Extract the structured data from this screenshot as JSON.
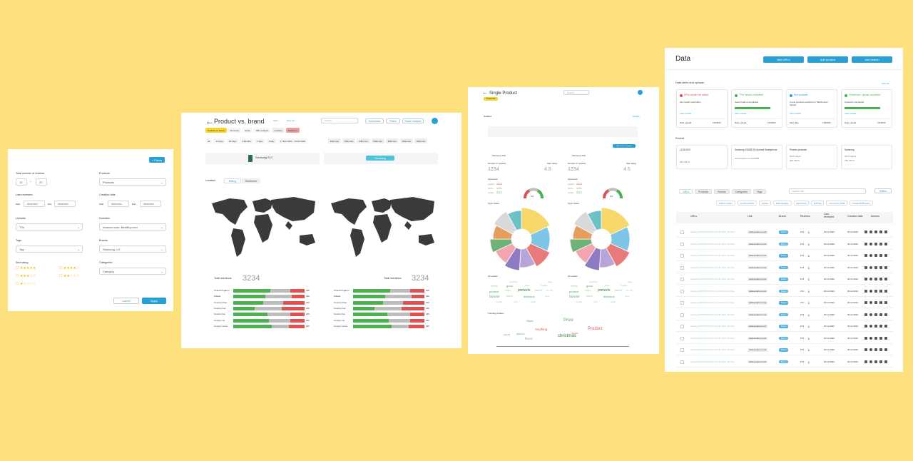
{
  "colors": {
    "bg": "#fde17e",
    "accent": "#2a9fd6",
    "green": "#4caf50",
    "red": "#e05252",
    "grey": "#bdbdbd",
    "yellow": "#f2d331"
  },
  "filters": {
    "edit_btn": "+ Filters",
    "total_reviews_label": "Total number of reviews",
    "reviews_from": "10",
    "reviews_dash": "–",
    "reviews_to": "20",
    "products_label": "Products",
    "products_value": "Products",
    "last_reviewed_label": "Last reviewed",
    "start_label": "Start",
    "start_value": "09/01/2021",
    "end_label": "End",
    "end_value": "09/01/2021",
    "creation_label": "Creation date",
    "creation_start_label": "Start",
    "creation_start_value": "09/01/2021",
    "creation_end_label": "End",
    "creation_end_value": "09/01/2021",
    "uploads_label": "Uploads",
    "uploads_value": "TVs",
    "domains_label": "Domains",
    "domains_value": "Amazon.com, BestBuy.com",
    "tags_label": "Tags",
    "tags_value": "Tag",
    "brands_label": "Brands",
    "brands_value": "Samsung, LG",
    "star_label": "Star rating",
    "categories_label": "Categories",
    "categories_value": "Category",
    "cancel": "Cancel",
    "apply": "Apply"
  },
  "pvb": {
    "title": "Product vs. brand",
    "save": "Save",
    "save_as": "Save As",
    "search_placeholder": "Search",
    "download": "Download",
    "filters": "Filters",
    "share": "Share analysis",
    "tabs": [
      "Product vs. brand",
      "Summary",
      "Entity",
      "HRL analysis",
      "Location",
      "Product 2"
    ],
    "ranges": [
      "All",
      "14 days",
      "30 days",
      "3 Months",
      "7 days",
      "Today",
      "17 Dec 2021 – 3 Feb 2022"
    ],
    "filter_chips": [
      "Filter two",
      "Filter two",
      "Filter two",
      "Filter two",
      "Filter two",
      "Filter two",
      "Filter two"
    ],
    "product_name": "Samsung S10",
    "brand_name": "Samsung",
    "location_label": "Location",
    "rating_tab": "Rating",
    "sentiment_tab": "Sentiment",
    "total_label": "Total mentions",
    "total_value": "3234",
    "countries": [
      "United Kingdom",
      "Poland",
      "Country three",
      "Country four",
      "Country five",
      "Country six",
      "Country seven"
    ],
    "country_values": [
      "400",
      "320",
      "230",
      "230",
      "230",
      "230",
      "230"
    ]
  },
  "single": {
    "title": "Single Product",
    "search_placeholder": "Search",
    "highlight_chip": "Product title",
    "section_label": "Detailed",
    "update_label": "Update",
    "chip_note": "Add more to compare",
    "product_a": "Samsung S10",
    "product_b": "Samsung S10",
    "reviews_label": "Number of reviews",
    "reviews_value": "1234",
    "rating_label": "Star rating",
    "rating_value": "4.5",
    "sentiment_label": "Sentiment",
    "neg_label": "negative",
    "neu_label": "neutral",
    "pos_label": "positive",
    "sent_vals": [
      "2312",
      "1211",
      "3112"
    ],
    "gauge_value": "6.6",
    "topic_label": "Topic wheel",
    "wordcloud_label": "All entities",
    "words": [
      "anything",
      "seems",
      "good",
      "taste",
      "product",
      "chips",
      "pretzels",
      "flavors",
      "favorite",
      "brand",
      "delicious",
      "healthy",
      "snack",
      "price",
      "great",
      "love",
      "crunch",
      "salty"
    ],
    "trending_label": "Trending entities",
    "trend_words": [
      "Price",
      "Product",
      "christmas",
      "flavor",
      "Anything",
      "Store",
      "brands",
      "delicious",
      "favorite"
    ]
  },
  "data_page": {
    "title": "Data",
    "add_urls": "Add URLs",
    "add_product": "Add product",
    "add_search": "Add search",
    "alerts_title": "Data alerts and uploads",
    "view_all": "View all",
    "alerts": [
      {
        "title": "URLs couldn't be added",
        "body": "We couldn't add URLs",
        "link": "View results",
        "meta_label": "Date upload",
        "meta_value": "13/06/22",
        "color": "#e05252"
      },
      {
        "title": "\"TVs\" search completed",
        "body": "Search add is completed",
        "link": "View results",
        "meta_label": "Date upload",
        "meta_value": "13/06/22",
        "color": "#4caf50"
      },
      {
        "title": "New products",
        "body": "3 new products searched in \"Electronics\" upload",
        "link": "View results",
        "meta_label": "Alert date",
        "meta_value": "13/06/22",
        "color": "#2a9fd6"
      },
      {
        "title": "\"Electronics\" upload completed",
        "body": "Upload is completed",
        "link": "View results",
        "meta_label": "Date upload",
        "meta_value": "13/06/22",
        "color": "#4caf50"
      }
    ],
    "recent_title": "Recent",
    "recent": [
      {
        "title": "LG B1XXX",
        "meta": "283 URLS"
      },
      {
        "title": "Samsung 128GB 5G Android Smartphone",
        "meta": "www.amazon.co.uk/s/B09"
      },
      {
        "title": "Phones products",
        "meta": "28 Products",
        "meta2": "283 URLS"
      },
      {
        "title": "Samsung",
        "meta": "28 Products",
        "meta2": "283 URLS"
      }
    ],
    "tabs": [
      "URLs",
      "Products",
      "Brands",
      "Categories",
      "Tags"
    ],
    "search_placeholder": "Search URL",
    "filters": "Filters",
    "actions": [
      "Add to project",
      "Create product",
      "Delete",
      "Edit category",
      "Edit brand",
      "Edit tag",
      "Connect to ROB",
      "Create ROB query"
    ],
    "columns": [
      "URLs",
      "Link",
      "Brand",
      "Reviews",
      "Last reviewed",
      "Creation date",
      "Actions"
    ],
    "row": {
      "url": "Samsung 55TU7020 55 inch 4K Ultra HD Sma",
      "link": "www.amazon.co.uk",
      "brand": "Brand",
      "reviews": "274",
      "last": "30.12.2022",
      "created": "30.12.2022"
    },
    "row_count": 12
  }
}
